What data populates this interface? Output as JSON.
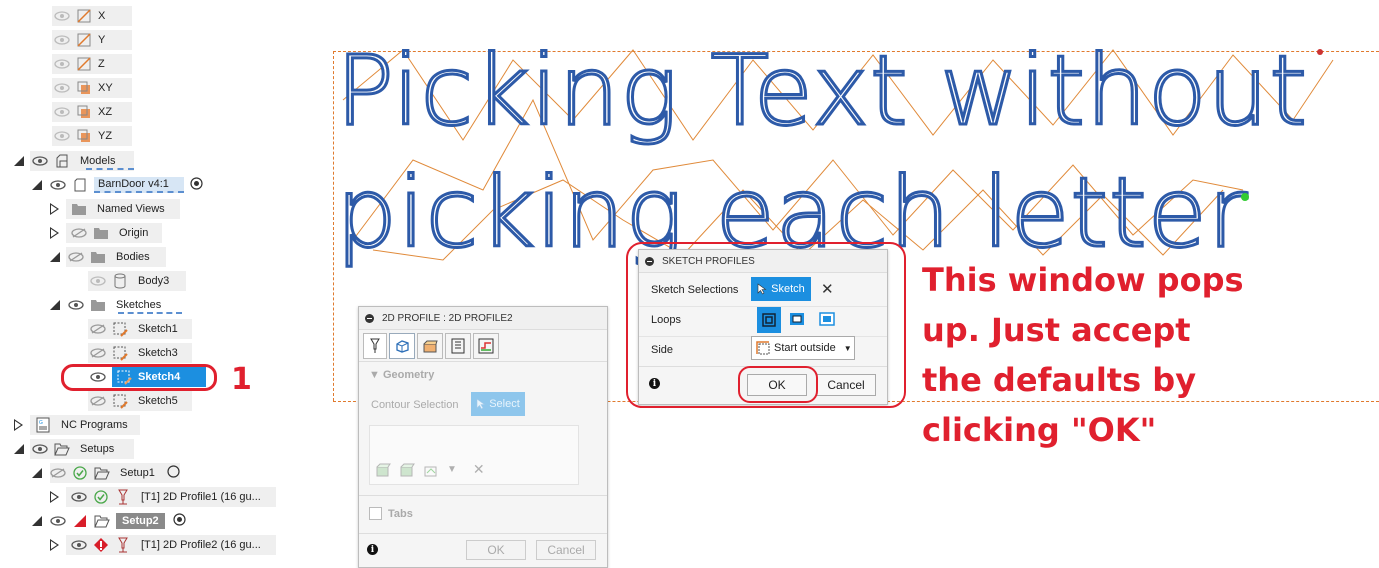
{
  "tree": {
    "axis_x": "X",
    "axis_y": "Y",
    "axis_z": "Z",
    "plane_xy": "XY",
    "plane_xz": "XZ",
    "plane_yz": "YZ",
    "models": "Models",
    "component": "BarnDoor v4:1",
    "named_views": "Named Views",
    "origin": "Origin",
    "bodies": "Bodies",
    "body3": "Body3",
    "sketches": "Sketches",
    "sketch1": "Sketch1",
    "sketch3": "Sketch3",
    "sketch4": "Sketch4",
    "sketch5": "Sketch5",
    "nc_programs": "NC Programs",
    "setups": "Setups",
    "setup1": "Setup1",
    "op1": "[T1] 2D Profile1 (16 gu...",
    "setup2": "Setup2",
    "op2": "[T1] 2D Profile2 (16 gu..."
  },
  "canvas": {
    "line1": "Picking Text without",
    "line2": "picking each letter"
  },
  "profile_dialog": {
    "title": "2D PROFILE : 2D PROFILE2",
    "geometry_label": "Geometry",
    "contour_label": "Contour Selection",
    "select_btn": "Select",
    "tabs_label": "Tabs",
    "ok": "OK",
    "cancel": "Cancel"
  },
  "sketch_dialog": {
    "title": "SKETCH PROFILES",
    "sel_label": "Sketch Selections",
    "sel_value": "Sketch",
    "loops_label": "Loops",
    "side_label": "Side",
    "side_value": "Start outside",
    "ok": "OK",
    "cancel": "Cancel"
  },
  "annotations": {
    "number": "1",
    "line1": "This window pops",
    "line2": "up. Just accept",
    "line3": "the defaults by",
    "line4": "clicking \"OK\""
  },
  "colors": {
    "annotation_red": "#e0202e",
    "selection_blue": "#1c8fe0",
    "boundary_orange": "#e07a2e",
    "text_profile_blue": "#2d5aa8"
  }
}
